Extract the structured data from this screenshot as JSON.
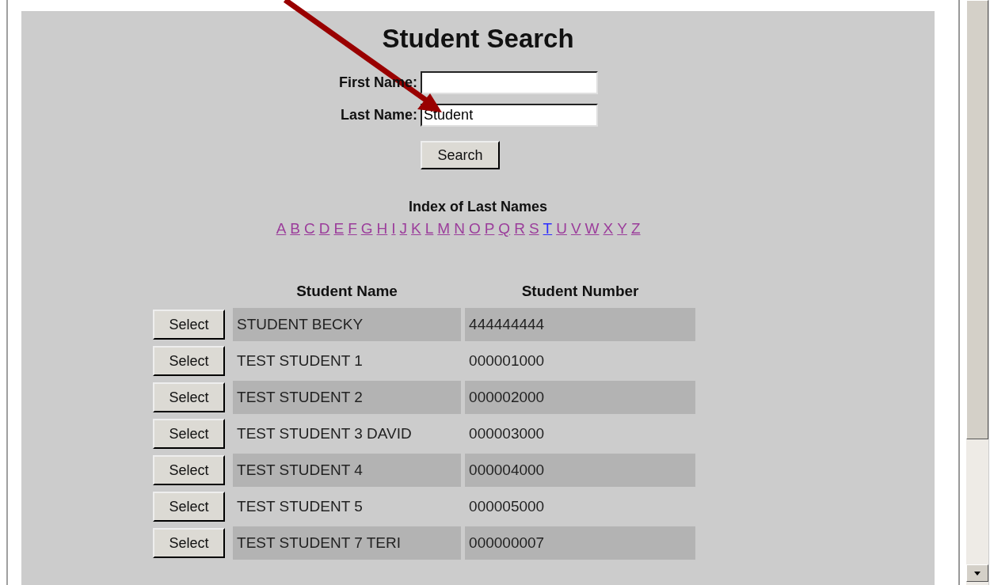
{
  "title": "Student Search",
  "form": {
    "fields": [
      {
        "label": "First Name:"
      },
      {
        "label": "Last Name:",
        "value": "Student"
      }
    ],
    "button": "Search"
  },
  "index": {
    "heading": "Index of Last Names",
    "letters": [
      {
        "letter": "A",
        "visited": true
      },
      {
        "letter": "B",
        "visited": true
      },
      {
        "letter": "C",
        "visited": true
      },
      {
        "letter": "D",
        "visited": true
      },
      {
        "letter": "E",
        "visited": true
      },
      {
        "letter": "F",
        "visited": true
      },
      {
        "letter": "G",
        "visited": true
      },
      {
        "letter": "H",
        "visited": true
      },
      {
        "letter": "I",
        "visited": true
      },
      {
        "letter": "J",
        "visited": true
      },
      {
        "letter": "K",
        "visited": true
      },
      {
        "letter": "L",
        "visited": true
      },
      {
        "letter": "M",
        "visited": true
      },
      {
        "letter": "N",
        "visited": true
      },
      {
        "letter": "O",
        "visited": true
      },
      {
        "letter": "P",
        "visited": true
      },
      {
        "letter": "Q",
        "visited": true
      },
      {
        "letter": "R",
        "visited": true
      },
      {
        "letter": "S",
        "visited": true
      },
      {
        "letter": "T",
        "visited": false
      },
      {
        "letter": "U",
        "visited": true
      },
      {
        "letter": "V",
        "visited": true
      },
      {
        "letter": "W",
        "visited": true
      },
      {
        "letter": "X",
        "visited": true
      },
      {
        "letter": "Y",
        "visited": true
      },
      {
        "letter": "Z",
        "visited": true
      }
    ]
  },
  "table": {
    "columns": [
      "Student Name",
      "Student Number"
    ],
    "rows": [
      {
        "button": "Select",
        "name": "STUDENT BECKY",
        "number": "444444444",
        "shaded": true
      },
      {
        "button": "Select",
        "name": "TEST STUDENT 1",
        "number": "000001000",
        "shaded": false
      },
      {
        "button": "Select",
        "name": "TEST STUDENT 2",
        "number": "000002000",
        "shaded": true
      },
      {
        "button": "Select",
        "name": "TEST STUDENT 3 DAVID",
        "number": "000003000",
        "shaded": false
      },
      {
        "button": "Select",
        "name": "TEST STUDENT 4",
        "number": "000004000",
        "shaded": true
      },
      {
        "button": "Select",
        "name": "TEST STUDENT 5",
        "number": "000005000",
        "shaded": false
      },
      {
        "button": "Select",
        "name": "TEST STUDENT 7 TERI",
        "number": "000000007",
        "shaded": true
      }
    ]
  }
}
